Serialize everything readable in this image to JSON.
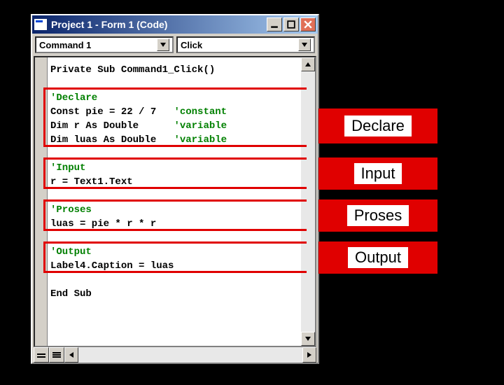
{
  "window": {
    "title": "Project 1 - Form 1 (Code)"
  },
  "dropdowns": {
    "object": "Command 1",
    "procedure": "Click"
  },
  "code": {
    "sub_open": "Private Sub Command1_Click()",
    "declare_comment": "'Declare",
    "declare_l1a": "Const pie = 22 / 7",
    "declare_l1b": "'constant",
    "declare_l2a": "Dim r As Double",
    "declare_l2b": "'variable",
    "declare_l3a": "Dim luas As Double",
    "declare_l3b": "'variable",
    "input_comment": "'Input",
    "input_l1": "r = Text1.Text",
    "proses_comment": "'Proses",
    "proses_l1": "luas = pie * r * r",
    "output_comment": "'Output",
    "output_l1": "Label4.Caption = luas",
    "sub_close": "End Sub"
  },
  "labels": {
    "declare": "Declare",
    "input": "Input",
    "proses": "Proses",
    "output": "Output"
  }
}
